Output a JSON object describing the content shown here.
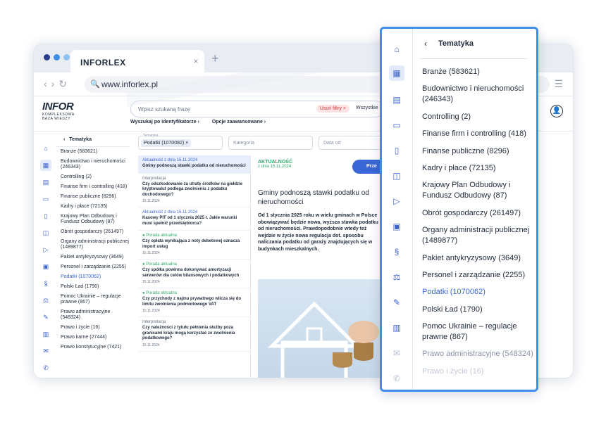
{
  "browser": {
    "tab_title": "INFORLEX",
    "tab_close": "×",
    "tab_add": "+",
    "url": "www.inforlex.pl",
    "dots": [
      "#2a3d8f",
      "#3d8ee6",
      "#8fc2f0"
    ]
  },
  "header": {
    "logo_main": "INFOR",
    "logo_sub1": "KOMPLEKSOWA",
    "logo_sub2": "BAZA WIEDZY",
    "search_placeholder": "Wpisz szukaną frazę",
    "filter_pill": "Usuń filtry ×",
    "search_scope": "Wszystkie k",
    "links": [
      "Wyszukaj po identyfikatorze ›",
      "Opcje zaawansowane ›"
    ]
  },
  "small_panel": {
    "title": "Tematyka",
    "back": "‹",
    "items": [
      {
        "label": "Branże (583621)"
      },
      {
        "label": "Budownictwo i nieruchomości (246343)"
      },
      {
        "label": "Controlling (2)"
      },
      {
        "label": "Finanse firm i controlling (418)"
      },
      {
        "label": "Finanse publiczne (8296)"
      },
      {
        "label": "Kadry i płace (72135)"
      },
      {
        "label": "Krajowy Plan Odbudowy i Fundusz Odbudowy (87)"
      },
      {
        "label": "Obrót gospodarczy (261497)"
      },
      {
        "label": "Organy administracji publicznej (1489877)"
      },
      {
        "label": "Pakiet antykryzysowy (3649)"
      },
      {
        "label": "Personel i zarządzanie (2255)"
      },
      {
        "label": "Podatki (1070062)"
      },
      {
        "label": "Polski Ład (1790)"
      },
      {
        "label": "Pomoc Ukrainie – regulacje prawne (867)"
      },
      {
        "label": "Prawo administracyjne (548324)"
      },
      {
        "label": "Prawo i życie (16)"
      },
      {
        "label": "Prawo karne (27444)"
      },
      {
        "label": "Prawo konstytucyjne (7421)"
      }
    ]
  },
  "filters": {
    "tematyka_label": "Tematyka",
    "tematyka_chip": "Podatki (1070082) ×",
    "kategoria": "Kategoria",
    "data_od": "Data od"
  },
  "results": [
    {
      "tag": "Aktualność z dnia 15.11.2024",
      "title": "Gminy podnoszą stawki podatku od nieruchomości",
      "date": "",
      "kind": "blue"
    },
    {
      "tag": "Interpretacja",
      "title": "Czy odszkodowanie za utratę środków na giełdzie kryptowalut podlega zwolnieniu z podatku dochodowego?",
      "date": "15.11.2024",
      "kind": "gray"
    },
    {
      "tag": "Aktualność z dnia 15.11.2024",
      "title": "Kasowy PIT od 1 stycznia 2025 r. Jakie warunki musi spełnić przedsiębiorca?",
      "date": "",
      "kind": "blue"
    },
    {
      "tag": "● Porada aktualna",
      "title": "Czy opłata wynikająca z noty debetowej oznacza import usług",
      "date": "15.11.2024",
      "kind": "green"
    },
    {
      "tag": "● Porada aktualna",
      "title": "Czy spółka powinna dokonywać amortyzacji serwerów dla celów bilansowych i podatkowych",
      "date": "15.11.2024",
      "kind": "green"
    },
    {
      "tag": "● Porada aktualna",
      "title": "Czy przychody z najmu prywatnego wlicza się do limitu zwolnienia podmiotowego VAT",
      "date": "15.11.2024",
      "kind": "green"
    },
    {
      "tag": "Interpretacja",
      "title": "Czy należności z tytułu pełnienia służby poza granicami kraju mogą korzystać ze zwolnienia podatkowego?",
      "date": "15.11.2024",
      "kind": "gray"
    }
  ],
  "article": {
    "kind": "AKTUALNOŚĆ",
    "date": "z dnia 15.11.2024",
    "button": "Prze",
    "title": "Gminy podnoszą stawki podatku od nieruchomości",
    "lead": "Od 1 stycznia 2025 roku w wielu gminach w Polsce obowiązywać będzie nowa, wyższa stawka podatku od nieruchomości. Prawdopodobnie wtedy też wejdzie w życie nowa regulacja dot. sposobu naliczania podatku od garaży znajdujących się w budynkach mieszkalnych."
  },
  "zoom": {
    "title": "Tematyka",
    "back": "‹",
    "items": [
      {
        "label": "Branże (583621)"
      },
      {
        "label": "Budownictwo i nieruchomości (246343)"
      },
      {
        "label": "Controlling (2)"
      },
      {
        "label": "Finanse firm i controlling (418)"
      },
      {
        "label": "Finanse publiczne (8296)"
      },
      {
        "label": "Kadry i płace (72135)"
      },
      {
        "label": "Krajowy Plan Odbudowy i Fundusz Odbudowy (87)"
      },
      {
        "label": "Obrót gospodarczy (261497)"
      },
      {
        "label": "Organy administracji publicznej (1489877)"
      },
      {
        "label": "Pakiet antykryzysowy (3649)"
      },
      {
        "label": "Personel i zarządzanie (2255)"
      },
      {
        "label": "Podatki (1070062)"
      },
      {
        "label": "Polski Ład (1790)"
      },
      {
        "label": "Pomoc Ukrainie – regulacje prawne (867)"
      },
      {
        "label": "Prawo administracyjne (548324)"
      },
      {
        "label": "Prawo i życie (16)"
      }
    ],
    "active_index": 11
  }
}
